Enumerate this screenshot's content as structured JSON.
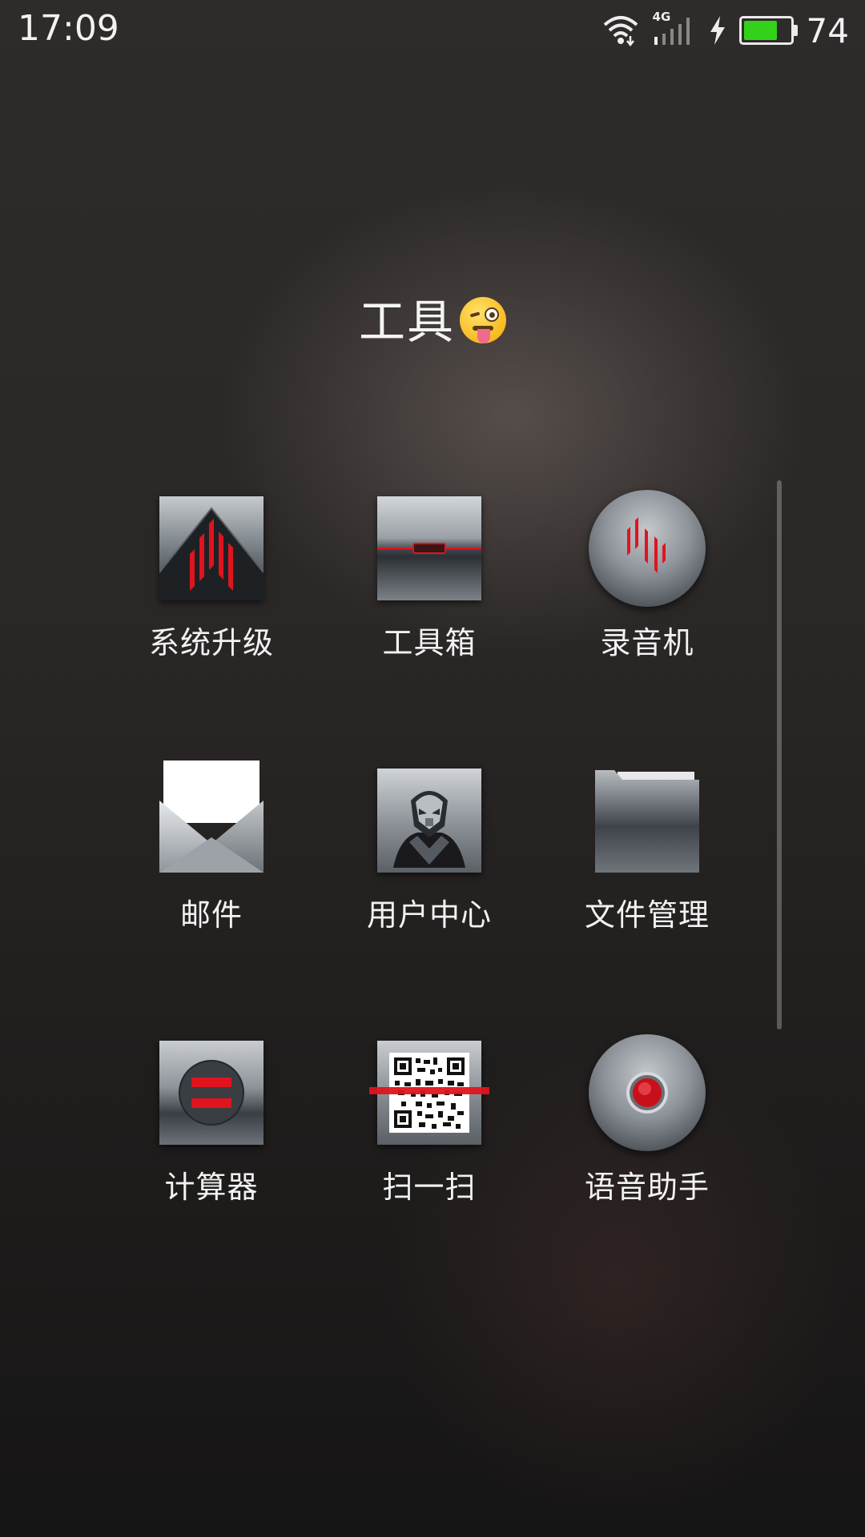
{
  "status_bar": {
    "time": "17:09",
    "network": "4G",
    "battery_percent": "74",
    "battery_level": 0.74,
    "icons": [
      "wifi-icon",
      "signal-icon",
      "charging-icon",
      "battery-icon"
    ]
  },
  "folder": {
    "title": "工具"
  },
  "apps": [
    {
      "label": "系统升级",
      "icon": "system-update-icon"
    },
    {
      "label": "工具箱",
      "icon": "toolbox-icon"
    },
    {
      "label": "录音机",
      "icon": "recorder-icon"
    },
    {
      "label": "邮件",
      "icon": "mail-icon"
    },
    {
      "label": "用户中心",
      "icon": "user-center-icon"
    },
    {
      "label": "文件管理",
      "icon": "folder-icon"
    },
    {
      "label": "计算器",
      "icon": "calculator-icon"
    },
    {
      "label": "扫一扫",
      "icon": "qr-scan-icon"
    },
    {
      "label": "语音助手",
      "icon": "voice-assistant-icon"
    }
  ],
  "colors": {
    "accent_red": "#e0141e",
    "battery_green": "#33d11a"
  }
}
